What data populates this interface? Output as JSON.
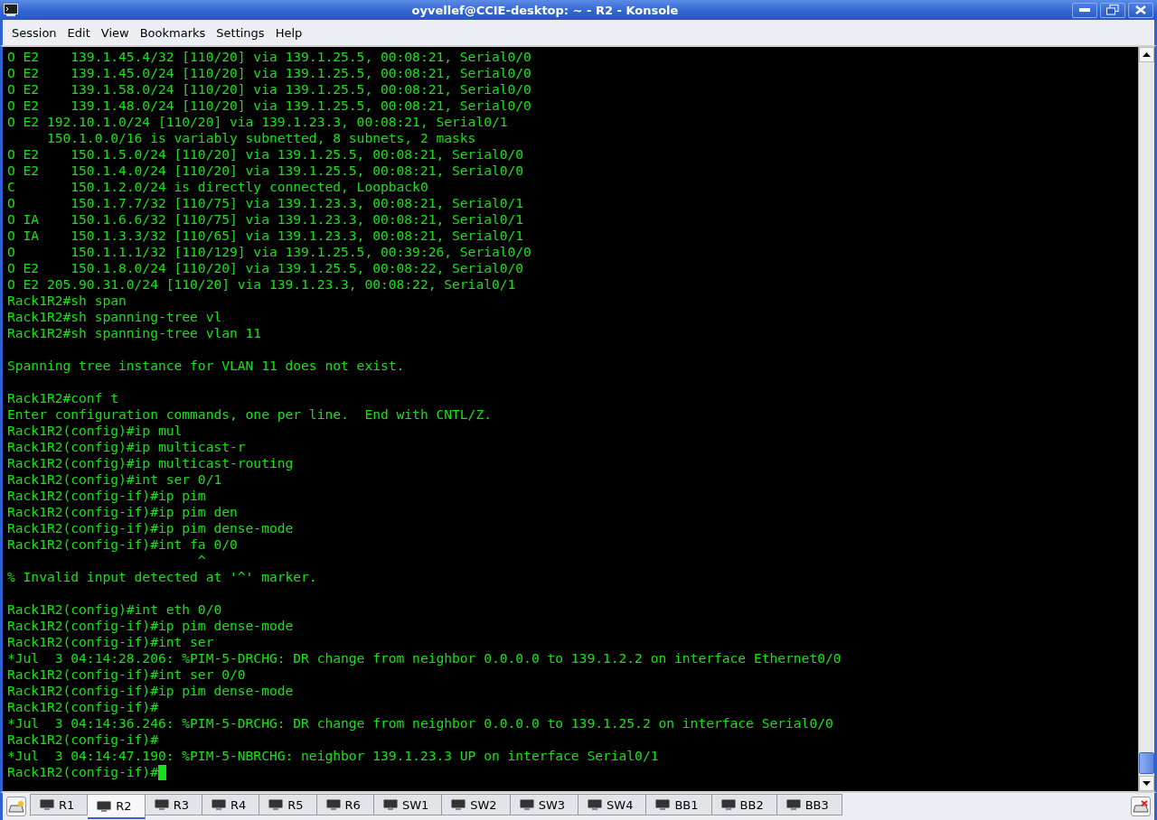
{
  "window": {
    "title": "oyvellef@CCIE-desktop: ~ - R2 - Konsole"
  },
  "menu": [
    "Session",
    "Edit",
    "View",
    "Bookmarks",
    "Settings",
    "Help"
  ],
  "terminal": {
    "cursor_visible": true,
    "blocks": [
      [
        "O E2    139.1.45.4/32 [110/20] via 139.1.25.5, 00:08:21, Serial0/0",
        "O E2    139.1.45.0/24 [110/20] via 139.1.25.5, 00:08:21, Serial0/0",
        "O E2    139.1.58.0/24 [110/20] via 139.1.25.5, 00:08:21, Serial0/0",
        "O E2    139.1.48.0/24 [110/20] via 139.1.25.5, 00:08:21, Serial0/0",
        "O E2 192.10.1.0/24 [110/20] via 139.1.23.3, 00:08:21, Serial0/1",
        "     150.1.0.0/16 is variably subnetted, 8 subnets, 2 masks",
        "O E2    150.1.5.0/24 [110/20] via 139.1.25.5, 00:08:21, Serial0/0",
        "O E2    150.1.4.0/24 [110/20] via 139.1.25.5, 00:08:21, Serial0/0",
        "C       150.1.2.0/24 is directly connected, Loopback0",
        "O       150.1.7.7/32 [110/75] via 139.1.23.3, 00:08:21, Serial0/1",
        "O IA    150.1.6.6/32 [110/75] via 139.1.23.3, 00:08:21, Serial0/1",
        "O IA    150.1.3.3/32 [110/65] via 139.1.23.3, 00:08:21, Serial0/1",
        "O       150.1.1.1/32 [110/129] via 139.1.25.5, 00:39:26, Serial0/0",
        "O E2    150.1.8.0/24 [110/20] via 139.1.25.5, 00:08:22, Serial0/0",
        "O E2 205.90.31.0/24 [110/20] via 139.1.23.3, 00:08:22, Serial0/1",
        "Rack1R2#sh span",
        "Rack1R2#sh spanning-tree vl",
        "Rack1R2#sh spanning-tree vlan 11"
      ],
      [
        "Spanning tree instance for VLAN 11 does not exist."
      ],
      [
        "Rack1R2#conf t",
        "Enter configuration commands, one per line.  End with CNTL/Z.",
        "Rack1R2(config)#ip mul",
        "Rack1R2(config)#ip multicast-r",
        "Rack1R2(config)#ip multicast-routing",
        "Rack1R2(config)#int ser 0/1",
        "Rack1R2(config-if)#ip pim",
        "Rack1R2(config-if)#ip pim den",
        "Rack1R2(config-if)#ip pim dense-mode",
        "Rack1R2(config-if)#int fa 0/0",
        "                        ^",
        "% Invalid input detected at '^' marker."
      ],
      [
        "Rack1R2(config)#int eth 0/0",
        "Rack1R2(config-if)#ip pim dense-mode",
        "Rack1R2(config-if)#int ser",
        "*Jul  3 04:14:28.206: %PIM-5-DRCHG: DR change from neighbor 0.0.0.0 to 139.1.2.2 on interface Ethernet0/0",
        "Rack1R2(config-if)#int ser 0/0",
        "Rack1R2(config-if)#ip pim dense-mode",
        "Rack1R2(config-if)#",
        "*Jul  3 04:14:36.246: %PIM-5-DRCHG: DR change from neighbor 0.0.0.0 to 139.1.25.2 on interface Serial0/0",
        "Rack1R2(config-if)#",
        "*Jul  3 04:14:47.190: %PIM-5-NBRCHG: neighbor 139.1.23.3 UP on interface Serial0/1",
        "Rack1R2(config-if)#"
      ]
    ]
  },
  "tabs": [
    {
      "label": "R1",
      "selected": false
    },
    {
      "label": "R2",
      "selected": true
    },
    {
      "label": "R3",
      "selected": false
    },
    {
      "label": "R4",
      "selected": false
    },
    {
      "label": "R5",
      "selected": false
    },
    {
      "label": "R6",
      "selected": false
    },
    {
      "label": "SW1",
      "selected": false
    },
    {
      "label": "SW2",
      "selected": false
    },
    {
      "label": "SW3",
      "selected": false
    },
    {
      "label": "SW4",
      "selected": false
    },
    {
      "label": "BB1",
      "selected": false
    },
    {
      "label": "BB2",
      "selected": false
    },
    {
      "label": "BB3",
      "selected": false
    }
  ]
}
